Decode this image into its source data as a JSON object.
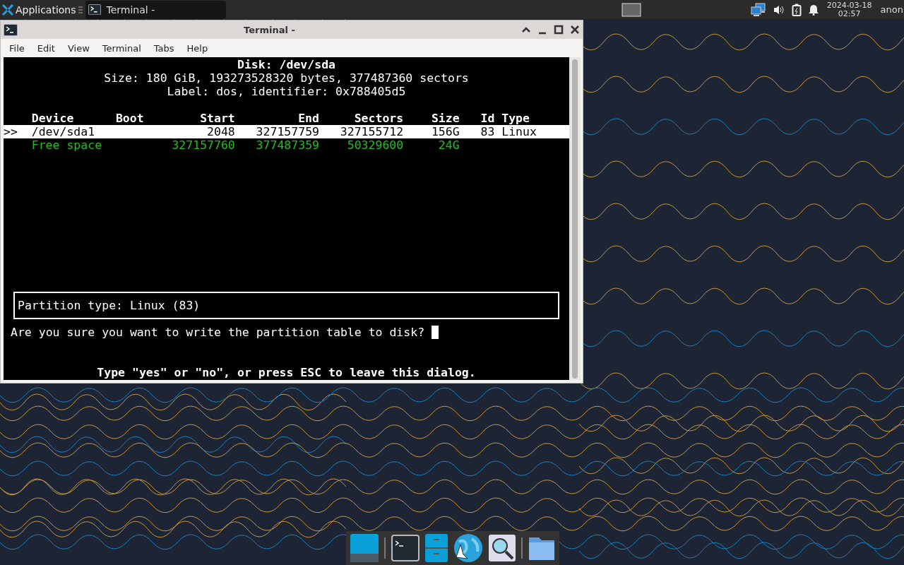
{
  "top_panel": {
    "app_menu": "Applications",
    "tasks": [
      {
        "title": "Terminal -",
        "selected": true
      }
    ],
    "clock": {
      "date": "2024-03-18",
      "time": "02:57"
    },
    "user": "anon"
  },
  "window": {
    "title": "Terminal -",
    "menu": [
      "File",
      "Edit",
      "View",
      "Terminal",
      "Tabs",
      "Help"
    ],
    "terminal": {
      "disk": "Disk: /dev/sda",
      "size_line": "Size: 180 GiB, 193273528320 bytes, 377487360 sectors",
      "label_line": "Label: dos, identifier: 0x788405d5",
      "columns": [
        "Device",
        "Boot",
        "Start",
        "End",
        "Sectors",
        "Size",
        "Id",
        "Type"
      ],
      "rows": [
        {
          "kind": "partition",
          "selected": true,
          "marker": ">>",
          "device": "/dev/sda1",
          "start": "2048",
          "end": "327157759",
          "sectors": "327155712",
          "size": "156G",
          "id": "83",
          "type": "Linux"
        },
        {
          "kind": "free",
          "selected": false,
          "device": "Free space",
          "start": "327157760",
          "end": "377487359",
          "sectors": "50329600",
          "size": "24G"
        }
      ],
      "partition_type": "Partition type: Linux (83)",
      "prompt": "Are you sure you want to write the partition table to disk?",
      "hint": "Type \"yes\" or \"no\", or press ESC to leave this dialog."
    }
  }
}
